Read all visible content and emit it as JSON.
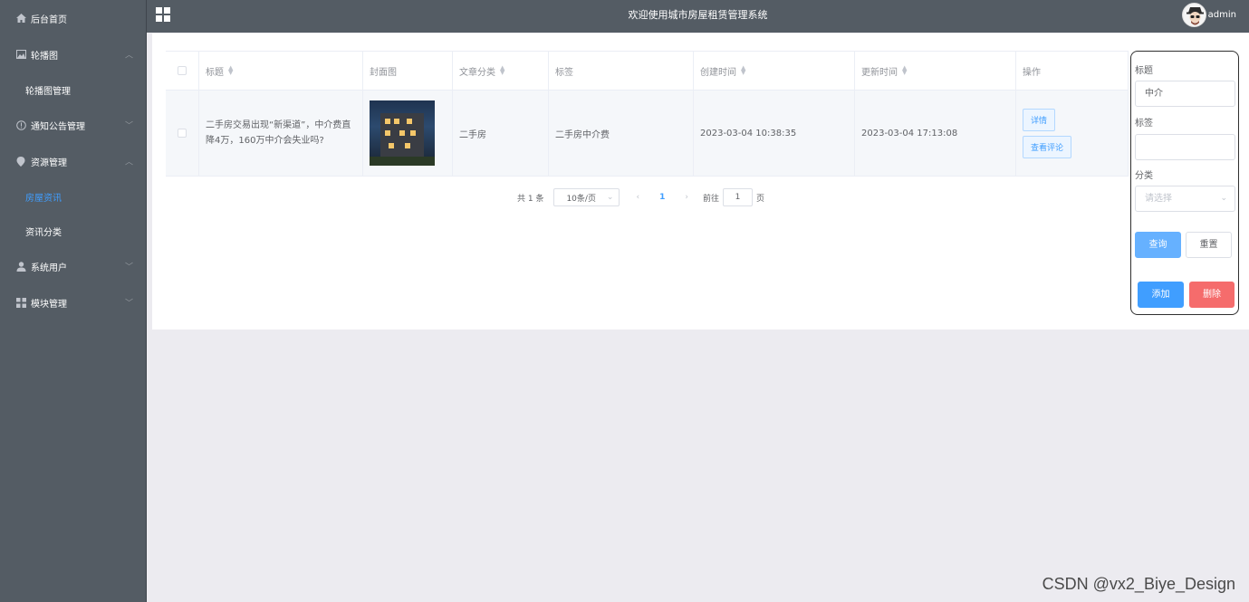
{
  "header": {
    "title": "欢迎使用城市房屋租赁管理系统",
    "username": "admin"
  },
  "sidebar": {
    "items": [
      {
        "label": "后台首页",
        "icon": "home-icon"
      },
      {
        "label": "轮播图",
        "icon": "image-icon",
        "children": [
          {
            "label": "轮播图管理"
          }
        ]
      },
      {
        "label": "通知公告管理",
        "icon": "info-icon"
      },
      {
        "label": "资源管理",
        "icon": "location-icon",
        "children": [
          {
            "label": "房屋资讯",
            "active": true
          },
          {
            "label": "资讯分类"
          }
        ]
      },
      {
        "label": "系统用户",
        "icon": "user-icon"
      },
      {
        "label": "模块管理",
        "icon": "grid-icon"
      }
    ]
  },
  "table": {
    "columns": [
      "标题",
      "封面图",
      "文章分类",
      "标签",
      "创建时间",
      "更新时间",
      "操作"
    ],
    "rows": [
      {
        "title": "二手房交易出现“新渠道”，中介费直降4万，160万中介会失业吗?",
        "category": "二手房",
        "tag": "二手房中介费",
        "created": "2023-03-04 10:38:35",
        "updated": "2023-03-04 17:13:08",
        "actions": [
          "详情",
          "查看评论"
        ]
      }
    ]
  },
  "pagination": {
    "total": "共 1 条",
    "page_size": "10条/页",
    "current_page": "1",
    "goto_prefix": "前往",
    "goto_value": "1",
    "goto_suffix": "页"
  },
  "search": {
    "title_label": "标题",
    "title_value": "中介",
    "tag_label": "标签",
    "tag_value": "",
    "category_label": "分类",
    "category_placeholder": "请选择",
    "query_label": "查询",
    "reset_label": "重置",
    "add_label": "添加",
    "delete_label": "删除"
  },
  "watermark": "CSDN @vx2_Biye_Design",
  "colors": {
    "sidebar_bg": "#545c64",
    "primary": "#409eff",
    "danger": "#f56c6c"
  }
}
